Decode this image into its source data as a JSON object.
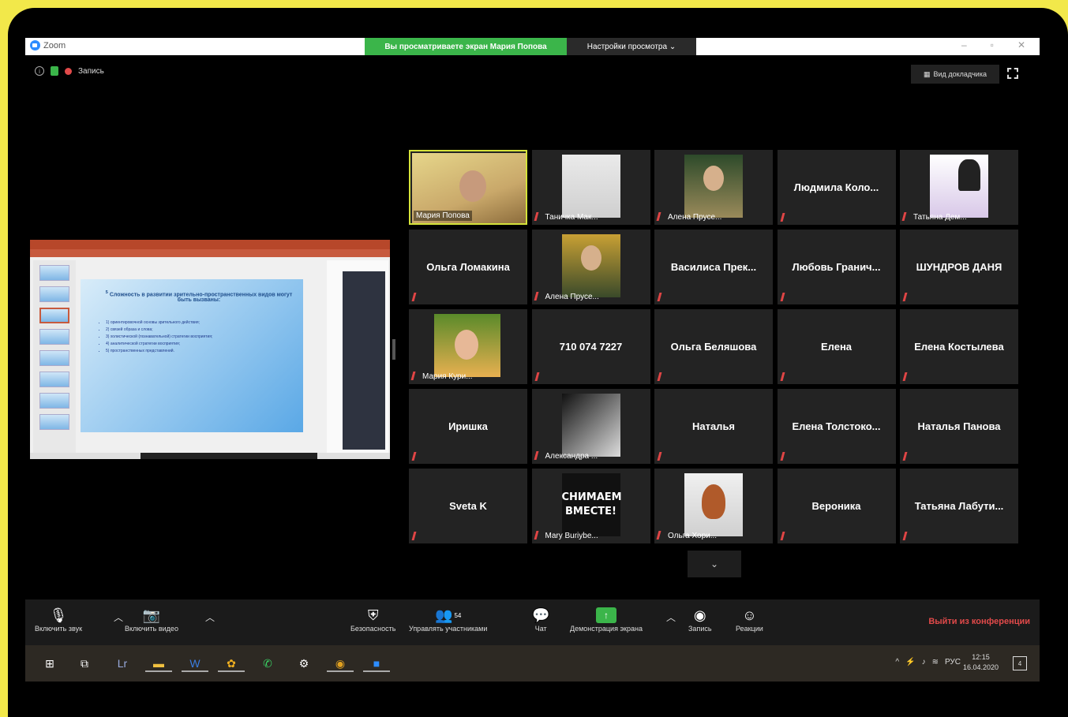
{
  "titlebar": {
    "app_title": "Zoom",
    "share_banner": "Вы просматриваете экран Мария Попова",
    "view_options": "Настройки просмотра ⌄"
  },
  "topinfo": {
    "recording": "Запись"
  },
  "speaker_view": "Вид докладчика",
  "slide": {
    "number": "5",
    "heading": "Сложность в развитии зрительно-пространственных видов могут быть вызваны:",
    "bullets": [
      "1) ориентировочной основы зрительного действия;",
      "2) связей образа и слова;",
      "3) холистической (познавательной) стратегии восприятия;",
      "4) аналитической стратегии восприятия;",
      "5) пространственных представлений."
    ]
  },
  "participants": [
    {
      "label": "Мария Попова",
      "photo": "p-maria",
      "active": true,
      "muted": false
    },
    {
      "label": "Таничка Мак...",
      "photo": "p-tan",
      "muted": true
    },
    {
      "label": "Алена Прусе...",
      "photo": "p-alena",
      "muted": true
    },
    {
      "name": "Людмила Коло...",
      "muted": true
    },
    {
      "label": "Татьяна Дем...",
      "photo": "p-tatyana",
      "muted": true
    },
    {
      "name": "Ольга Ломакина",
      "muted": true
    },
    {
      "label": "Алена Прусе...",
      "photo": "p-alena2",
      "muted": true
    },
    {
      "name": "Василиса Прек...",
      "muted": true
    },
    {
      "name": "Любовь Гранич...",
      "muted": true
    },
    {
      "name": "ШУНДРОВ ДАНЯ",
      "muted": true
    },
    {
      "label": "Мария Кури...",
      "photo": "p-kur",
      "muted": true
    },
    {
      "name": "710 074 7227",
      "muted": true
    },
    {
      "name": "Ольга Беляшова",
      "muted": true
    },
    {
      "name": "Елена",
      "muted": true
    },
    {
      "name": "Елена Костылева",
      "muted": true
    },
    {
      "name": "Иришка",
      "muted": true
    },
    {
      "label": "Александра ...",
      "photo": "p-alex",
      "muted": true
    },
    {
      "name": "Наталья",
      "muted": true
    },
    {
      "name": "Елена Толстоко...",
      "muted": true
    },
    {
      "name": "Наталья Панова",
      "muted": true
    },
    {
      "name": "Sveta K",
      "muted": true
    },
    {
      "label": "Mary Buriybe...",
      "photo": "p-mary",
      "photo_text": "СНИМАЕМ ВМЕСТЕ!",
      "muted": true
    },
    {
      "label": "Ольга Хори...",
      "photo": "p-olga",
      "muted": true
    },
    {
      "name": "Вероника",
      "muted": true
    },
    {
      "name": "Татьяна Лабути...",
      "muted": true
    }
  ],
  "toolbar": {
    "unmute": "Включить звук",
    "start_video": "Включить видео",
    "security": "Безопасность",
    "participants": "Управлять участниками",
    "participants_count": "54",
    "chat": "Чат",
    "share": "Демонстрация экрана",
    "record": "Запись",
    "reactions": "Реакции",
    "leave": "Выйти из конференции"
  },
  "taskbar": {
    "language": "РУС",
    "time": "12:15",
    "date": "16.04.2020",
    "notifications": "4"
  }
}
